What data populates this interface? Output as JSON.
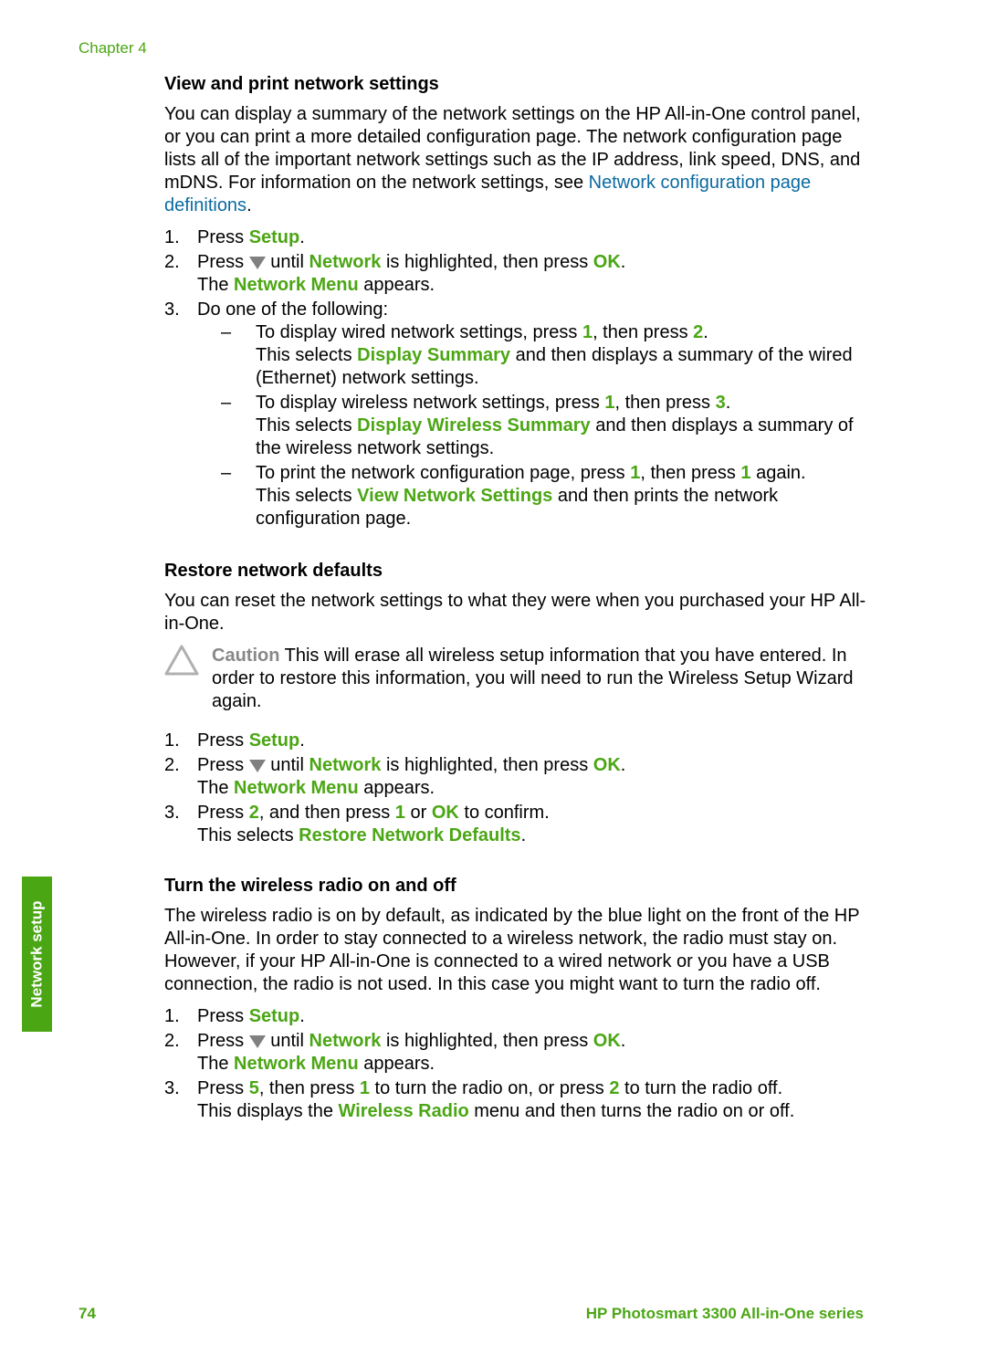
{
  "chapter": "Chapter 4",
  "sidebarTab": "Network setup",
  "section1": {
    "heading": "View and print network settings",
    "intro_a": "You can display a summary of the network settings on the HP All-in-One control panel, or you can print a more detailed configuration page. The network configuration page lists all of the important network settings such as the IP address, link speed, DNS, and mDNS. For information on the network settings, see ",
    "intro_link": "Network configuration page definitions",
    "step1_pre": "Press ",
    "setup": "Setup",
    "step2_pre": "Press ",
    "step2_mid": " until ",
    "network": "Network",
    "step2_post": " is highlighted, then press ",
    "ok": "OK",
    "step2_line2a": "The ",
    "networkMenu": "Network Menu",
    "step2_line2b": " appears.",
    "step3": "Do one of the following:",
    "bullet1a": "To display wired network settings, press ",
    "one": "1",
    "bullet1b": ", then press ",
    "two": "2",
    "bullet1c_a": "This selects ",
    "displaySummary": "Display Summary",
    "bullet1c_b": " and then displays a summary of the wired (Ethernet) network settings.",
    "bullet2a": "To display wireless network settings, press ",
    "three": "3",
    "bullet2c_a": "This selects ",
    "displayWireless": "Display Wireless Summary",
    "bullet2c_b": " and then displays a summary of the wireless network settings.",
    "bullet3a": "To print the network configuration page, press ",
    "bullet3b": " again.",
    "bullet3c_a": "This selects ",
    "viewNetworkSettings": "View Network Settings",
    "bullet3c_b": " and then prints the network configuration page."
  },
  "section2": {
    "heading": "Restore network defaults",
    "intro": "You can reset the network settings to what they were when you purchased your HP All-in-One.",
    "cautionLabel": "Caution",
    "cautionText": "   This will erase all wireless setup information that you have entered. In order to restore this information, you will need to run the Wireless Setup Wizard again.",
    "step3a": "Press ",
    "step3b": ", and then press ",
    "step3c": " or ",
    "step3d": " to confirm.",
    "step3e_a": "This selects ",
    "restoreDefaults": "Restore Network Defaults"
  },
  "section3": {
    "heading": "Turn the wireless radio on and off",
    "intro": "The wireless radio is on by default, as indicated by the blue light on the front of the HP All-in-One. In order to stay connected to a wireless network, the radio must stay on. However, if your HP All-in-One is connected to a wired network or you have a USB connection, the radio is not used. In this case you might want to turn the radio off.",
    "step3a": "Press ",
    "five": "5",
    "step3b": ", then press ",
    "step3c": " to turn the radio on, or press ",
    "step3d": " to turn the radio off.",
    "step3e_a": "This displays the ",
    "wirelessRadio": "Wireless Radio",
    "step3e_b": " menu and then turns the radio on or off."
  },
  "footer": {
    "pageNum": "74",
    "product": "HP Photosmart 3300 All-in-One series"
  }
}
